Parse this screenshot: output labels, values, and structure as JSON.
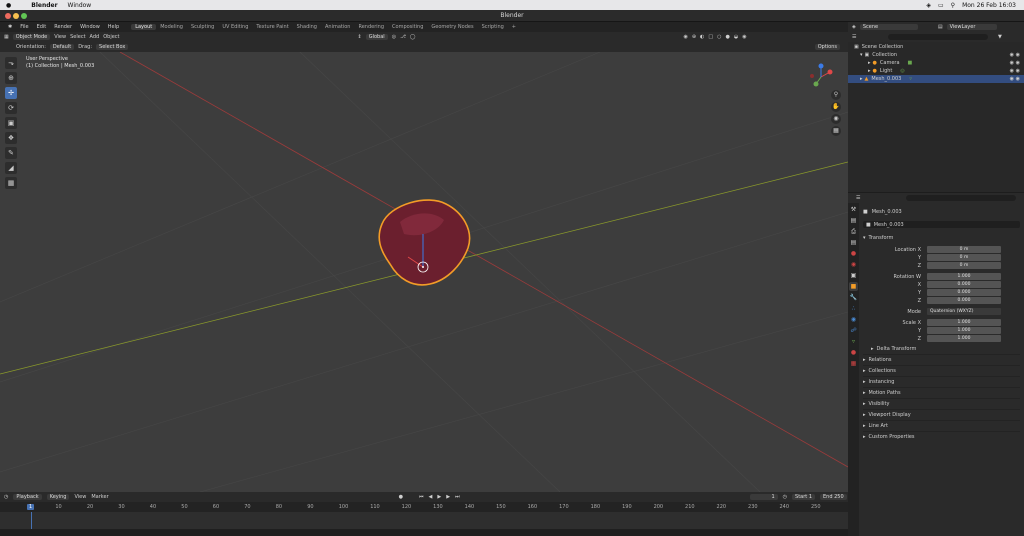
{
  "menubar": {
    "apple_icon": "apple-icon",
    "app_name": "Blender",
    "window_menu": "Window",
    "clock": "Mon 26 Feb 16:03"
  },
  "window": {
    "title": "Blender"
  },
  "topbar": {
    "menus": [
      "File",
      "Edit",
      "Render",
      "Window",
      "Help"
    ],
    "workspaces": [
      "Layout",
      "Modeling",
      "Sculpting",
      "UV Editing",
      "Texture Paint",
      "Shading",
      "Animation",
      "Rendering",
      "Compositing",
      "Geometry Nodes",
      "Scripting"
    ],
    "active_workspace": "Layout",
    "add_tab": "+"
  },
  "viewport_header": {
    "mode": "Object Mode",
    "menus": [
      "View",
      "Select",
      "Add",
      "Object"
    ],
    "transform_orientation": "Global",
    "options": "Options"
  },
  "viewport_header2": {
    "orientation_label": "Orientation:",
    "orientation_value": "Default",
    "drag_label": "Drag:",
    "drag_value": "Select Box"
  },
  "viewport": {
    "perspective": "User Perspective",
    "collection_info": "(1) Collection | Mesh_0.003",
    "object_color": "#6b1f2e",
    "outline_color": "#f39c27",
    "floor_color": "#3d3d3d"
  },
  "timeline": {
    "menus": [
      "Playback",
      "Keying",
      "View",
      "Marker"
    ],
    "current_frame": "1",
    "start_label": "Start",
    "start_value": "1",
    "end_label": "End",
    "end_value": "250",
    "ruler": [
      "1",
      "10",
      "20",
      "30",
      "40",
      "50",
      "60",
      "70",
      "80",
      "90",
      "100",
      "110",
      "120",
      "130",
      "140",
      "150",
      "160",
      "170",
      "180",
      "190",
      "200",
      "210",
      "220",
      "230",
      "240",
      "250"
    ]
  },
  "outliner": {
    "scene": "Scene",
    "view_layer": "ViewLayer",
    "rows": [
      {
        "label": "Scene Collection",
        "indent": 0,
        "icon": "collection-icon"
      },
      {
        "label": "Collection",
        "indent": 1,
        "icon": "collection-icon"
      },
      {
        "label": "Camera",
        "indent": 2,
        "icon": "camera-icon"
      },
      {
        "label": "Light",
        "indent": 2,
        "icon": "light-icon"
      },
      {
        "label": "Mesh_0.003",
        "indent": 1,
        "icon": "mesh-icon",
        "selected": true
      }
    ]
  },
  "properties": {
    "object_name": "Mesh_0.003",
    "datablock": "Mesh_0.003",
    "transform_title": "Transform",
    "location_label": "Location X",
    "loc": {
      "x": "0 m",
      "y": "0 m",
      "z": "0 m"
    },
    "rotation_label": "Rotation W",
    "rot": {
      "w": "1.000",
      "x": "0.000",
      "y": "0.000",
      "z": "0.000"
    },
    "mode_label": "Mode",
    "mode_value": "Quaternion (WXYZ)",
    "scale_label": "Scale X",
    "scale": {
      "x": "1.000",
      "y": "1.000",
      "z": "1.000"
    },
    "axis_y": "Y",
    "axis_z": "Z",
    "axis_x": "X",
    "delta": "Delta Transform",
    "sections": [
      "Relations",
      "Collections",
      "Instancing",
      "Motion Paths",
      "Visibility",
      "Viewport Display",
      "Line Art",
      "Custom Properties"
    ]
  }
}
